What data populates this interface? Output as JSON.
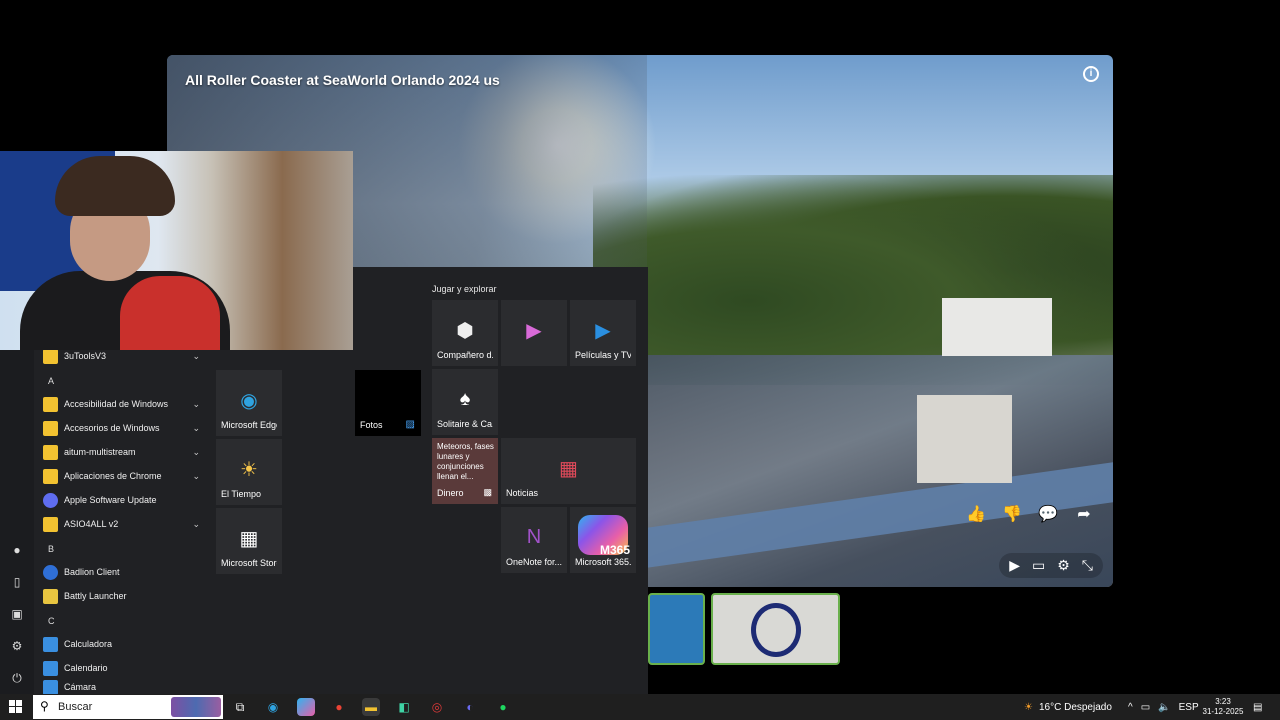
{
  "video": {
    "title": "All Roller Coaster at SeaWorld Orlando 2024 us"
  },
  "start_menu": {
    "app_list": [
      {
        "label": "3uToolsV3",
        "type": "folder",
        "expandable": true
      },
      {
        "header": "A"
      },
      {
        "label": "Accesibilidad de Windows",
        "type": "folder",
        "expandable": true
      },
      {
        "label": "Accesorios de Windows",
        "type": "folder",
        "expandable": true
      },
      {
        "label": "aitum-multistream",
        "type": "folder",
        "expandable": true
      },
      {
        "label": "Aplicaciones de Chrome",
        "type": "folder",
        "expandable": true
      },
      {
        "label": "Apple Software Update",
        "type": "app",
        "expandable": false
      },
      {
        "label": "ASIO4ALL v2",
        "type": "folder",
        "expandable": true
      },
      {
        "header": "B"
      },
      {
        "label": "Badlion Client",
        "type": "app",
        "expandable": false
      },
      {
        "label": "Battly Launcher",
        "type": "app",
        "expandable": false
      },
      {
        "header": "C"
      },
      {
        "label": "Calculadora",
        "type": "app",
        "expandable": false
      },
      {
        "label": "Calendario",
        "type": "app",
        "expandable": false
      },
      {
        "label": "Cámara",
        "type": "app",
        "expandable": false
      }
    ],
    "section_title": "Jugar y explorar",
    "tiles": {
      "edge": "Microsoft Edge",
      "weather": "El Tiempo",
      "store": "Microsoft Store",
      "photos": "Fotos",
      "companion": "Compañero d...",
      "movies": "Películas y TV",
      "solitaire": "Solitaire & Ca...",
      "money_headline": "Meteoros, fases lunares y conjunciones llenan el...",
      "money": "Dinero",
      "news": "Noticias",
      "onenote": "OneNote for...",
      "m365": "Microsoft 365...",
      "m365_badge": "M365"
    }
  },
  "taskbar": {
    "search_placeholder": "Buscar",
    "weather": "16°C  Despejado",
    "language": "ESP",
    "time": "3:23",
    "date": "31-12-2025"
  },
  "colors": {
    "taskbar": "#1f1f1f",
    "start_bg": "#202124",
    "tile_bg": "#2b2c2f",
    "folder": "#f2c231",
    "thumb_border": "#6ab04c"
  }
}
